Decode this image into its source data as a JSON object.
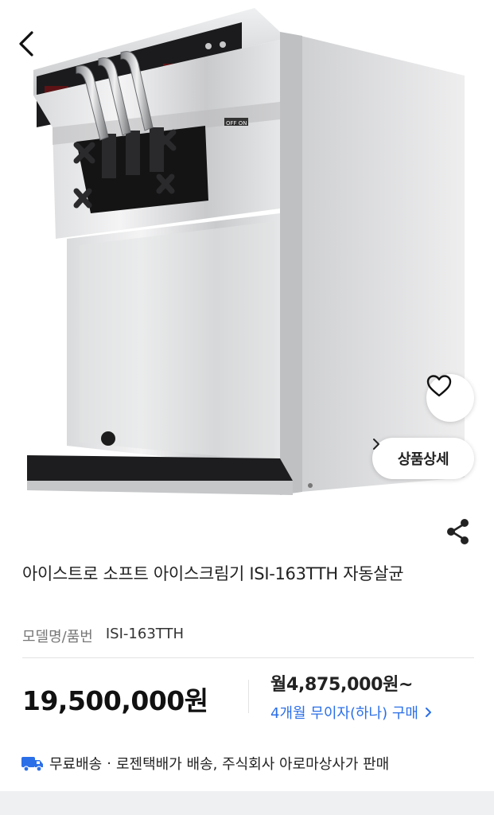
{
  "nav": {
    "back_icon": "chevron-left-icon"
  },
  "hero": {
    "wish_icon": "heart-icon",
    "detail_label": "상품상세",
    "detail_icon": "chevron-right-icon",
    "panel_text": "OFF ON"
  },
  "product": {
    "share_icon": "share-icon",
    "title": "아이스트로 소프트 아이스크림기 ISI-163TTH 자동살균",
    "model_label": "모델명/품번",
    "model_value": "ISI-163TTH"
  },
  "pricing": {
    "price": "19,500,000원",
    "monthly": "월4,875,000원~",
    "installment_text": "4개월 무이자(하나) 구매"
  },
  "shipping": {
    "icon": "truck-icon",
    "free_label": "무료배송",
    "dot": "·",
    "detail": "로젠택배가 배송, 주식회사 아로마상사가 판매"
  },
  "colors": {
    "accent_blue": "#2b6fe8",
    "truck_blue": "#2b6fe8"
  }
}
